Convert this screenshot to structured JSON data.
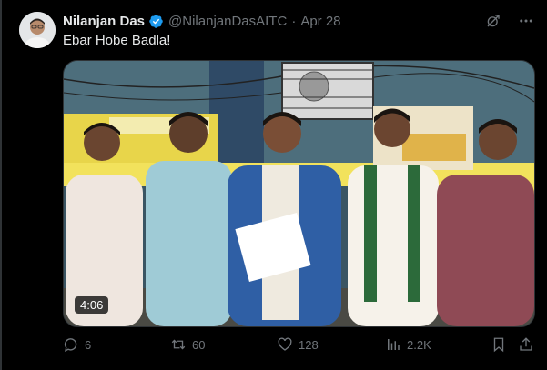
{
  "tweet": {
    "display_name": "Nilanjan Das",
    "handle": "@NilanjanDasAITC",
    "separator": "·",
    "timestamp": "Apr 28",
    "text": "Ebar Hobe Badla!",
    "verified_icon": "verified-badge-icon",
    "avatar_icon": "profile-avatar"
  },
  "media": {
    "type": "video",
    "duration": "4:06"
  },
  "actions": {
    "replies": "6",
    "reposts": "60",
    "likes": "128",
    "views": "2.2K"
  },
  "icons": {
    "grok": "grok-icon",
    "more": "more-icon",
    "reply": "reply-icon",
    "repost": "repost-icon",
    "like": "heart-icon",
    "views": "views-icon",
    "bookmark": "bookmark-icon",
    "share": "share-icon"
  },
  "colors": {
    "background": "#000000",
    "text_primary": "#e7e9ea",
    "text_secondary": "#71767b",
    "verified": "#1d9bf0",
    "border": "#2f3336"
  }
}
